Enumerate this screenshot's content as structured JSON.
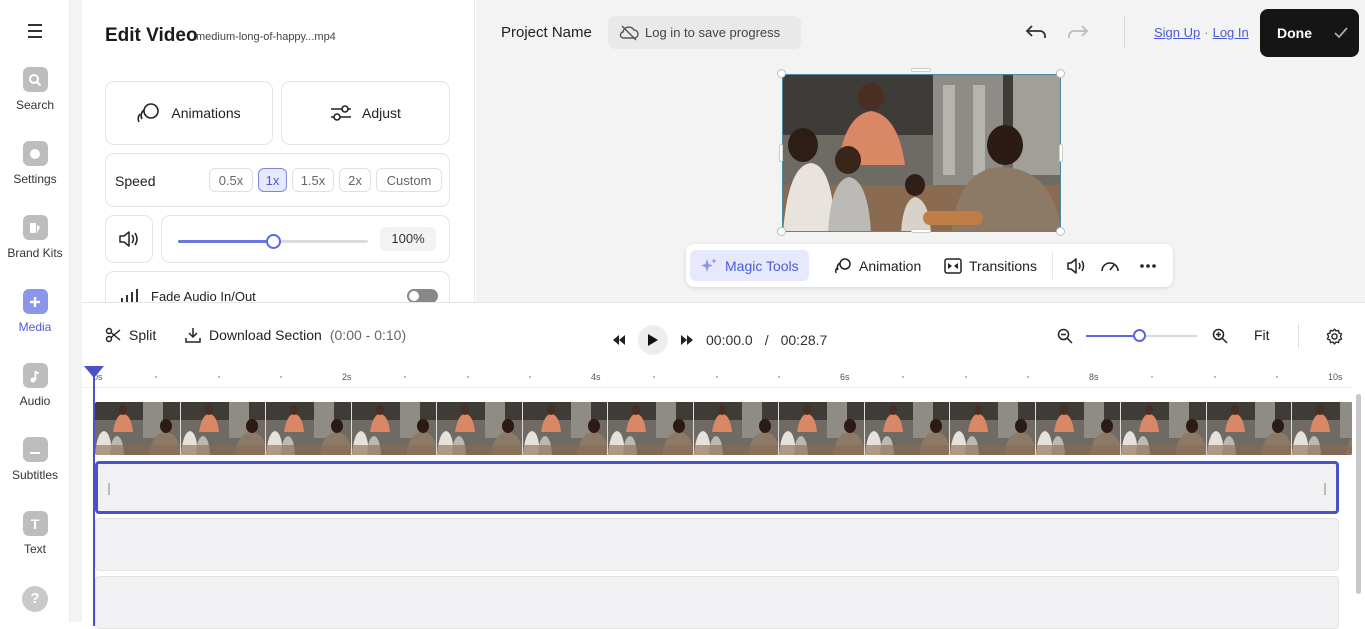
{
  "sidebar": {
    "items": [
      {
        "label": "Search",
        "icon": "search-icon"
      },
      {
        "label": "Settings",
        "icon": "settings-icon"
      },
      {
        "label": "Brand Kits",
        "icon": "brand-kits-icon"
      },
      {
        "label": "Media",
        "icon": "plus-icon",
        "active": true
      },
      {
        "label": "Audio",
        "icon": "music-note-icon"
      },
      {
        "label": "Subtitles",
        "icon": "subtitles-icon"
      },
      {
        "label": "Text",
        "icon": "text-icon",
        "glyph": "T"
      }
    ],
    "help_glyph": "?"
  },
  "edit_panel": {
    "title": "Edit Video",
    "filename": "medium-long-of-happy...mp4",
    "animations_label": "Animations",
    "adjust_label": "Adjust",
    "speed_label": "Speed",
    "speed_options": [
      "0.5x",
      "1x",
      "1.5x",
      "2x",
      "Custom"
    ],
    "speed_selected": "1x",
    "volume_value": "100%",
    "volume_level": 0.5,
    "fade_label": "Fade Audio In/Out",
    "fade_enabled": false
  },
  "header": {
    "project_name": "Project Name",
    "login_prompt": "Log in to save progress",
    "sign_up": "Sign Up",
    "separator": "·",
    "log_in": "Log In",
    "done": "Done"
  },
  "preview_toolbar": {
    "magic_tools": "Magic Tools",
    "animation": "Animation",
    "transitions": "Transitions"
  },
  "timeline_controls": {
    "split": "Split",
    "download_section": "Download Section",
    "download_range": "(0:00 - 0:10)",
    "current_time": "00:00.0",
    "time_separator": "/",
    "total_time": "00:28.7",
    "fit": "Fit",
    "zoom_level": 0.48
  },
  "ruler": {
    "labels": [
      "0s",
      "2s",
      "4s",
      "6s",
      "8s",
      "10s"
    ]
  },
  "colors": {
    "accent": "#4b5bd6",
    "selection": "#4a53c6",
    "done_bg": "#151515"
  }
}
